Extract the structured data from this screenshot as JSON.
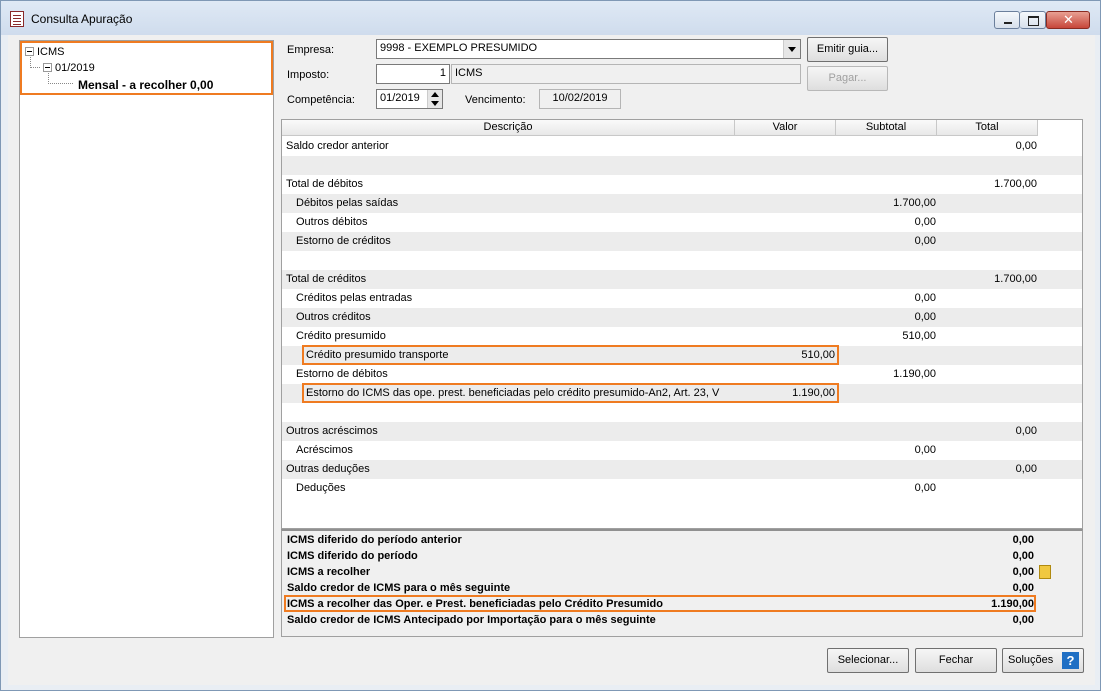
{
  "window": {
    "title": "Consulta Apuração"
  },
  "tree": {
    "root": "ICMS",
    "child": "01/2019",
    "leaf": "Mensal - a recolher 0,00"
  },
  "form": {
    "empresa_label": "Empresa:",
    "empresa_value": "9998 - EXEMPLO PRESUMIDO",
    "imposto_label": "Imposto:",
    "imposto_code": "1",
    "imposto_name": "ICMS",
    "competencia_label": "Competência:",
    "competencia_value": "01/2019",
    "vencimento_label": "Vencimento:",
    "vencimento_value": "10/02/2019",
    "emitir_guia": "Emitir guia...",
    "pagar": "Pagar..."
  },
  "grid": {
    "headers": [
      "Descrição",
      "Valor",
      "Subtotal",
      "Total"
    ],
    "rows": [
      {
        "d": "Saldo credor anterior",
        "indent": 0,
        "valor": "",
        "subtotal": "",
        "total": "0,00"
      },
      {
        "d": "",
        "indent": 0,
        "valor": "",
        "subtotal": "",
        "total": ""
      },
      {
        "d": "Total de débitos",
        "indent": 0,
        "valor": "",
        "subtotal": "",
        "total": "1.700,00"
      },
      {
        "d": "Débitos pelas saídas",
        "indent": 1,
        "valor": "",
        "subtotal": "1.700,00",
        "total": ""
      },
      {
        "d": "Outros débitos",
        "indent": 1,
        "valor": "",
        "subtotal": "0,00",
        "total": ""
      },
      {
        "d": "Estorno de créditos",
        "indent": 1,
        "valor": "",
        "subtotal": "0,00",
        "total": ""
      },
      {
        "d": "",
        "indent": 0,
        "valor": "",
        "subtotal": "",
        "total": ""
      },
      {
        "d": "Total de créditos",
        "indent": 0,
        "valor": "",
        "subtotal": "",
        "total": "1.700,00"
      },
      {
        "d": "Créditos pelas entradas",
        "indent": 1,
        "valor": "",
        "subtotal": "0,00",
        "total": ""
      },
      {
        "d": "Outros créditos",
        "indent": 1,
        "valor": "",
        "subtotal": "0,00",
        "total": ""
      },
      {
        "d": "Crédito presumido",
        "indent": 1,
        "valor": "",
        "subtotal": "510,00",
        "total": ""
      },
      {
        "d": "Crédito presumido transporte",
        "indent": 2,
        "valor": "510,00",
        "subtotal": "",
        "total": ""
      },
      {
        "d": "Estorno de débitos",
        "indent": 1,
        "valor": "",
        "subtotal": "1.190,00",
        "total": ""
      },
      {
        "d": "Estorno do ICMS das ope. prest. beneficiadas pelo crédito presumido-An2, Art. 23, V",
        "indent": 2,
        "valor": "1.190,00",
        "subtotal": "",
        "total": ""
      },
      {
        "d": "",
        "indent": 0,
        "valor": "",
        "subtotal": "",
        "total": ""
      },
      {
        "d": "Outros acréscimos",
        "indent": 0,
        "valor": "",
        "subtotal": "",
        "total": "0,00"
      },
      {
        "d": "Acréscimos",
        "indent": 1,
        "valor": "",
        "subtotal": "0,00",
        "total": ""
      },
      {
        "d": "Outras deduções",
        "indent": 0,
        "valor": "",
        "subtotal": "",
        "total": "0,00"
      },
      {
        "d": "Deduções",
        "indent": 1,
        "valor": "",
        "subtotal": "0,00",
        "total": ""
      }
    ]
  },
  "summary": [
    {
      "d": "ICMS diferido do período anterior",
      "v": "0,00"
    },
    {
      "d": "ICMS diferido do período",
      "v": "0,00"
    },
    {
      "d": "ICMS a recolher",
      "v": "0,00"
    },
    {
      "d": "Saldo credor de ICMS para o mês seguinte",
      "v": "0,00"
    },
    {
      "d": "ICMS a recolher das Oper. e Prest. beneficiadas pelo Crédito Presumido",
      "v": "1.190,00"
    },
    {
      "d": "Saldo credor de ICMS Antecipado por Importação para o mês seguinte",
      "v": "0,00"
    }
  ],
  "footer": {
    "selecionar": "Selecionar...",
    "fechar": "Fechar",
    "solucoes": "Soluções",
    "help": "?"
  },
  "colors": {
    "highlight": "#ef7b21",
    "help_icon": "#1f6fc4"
  }
}
